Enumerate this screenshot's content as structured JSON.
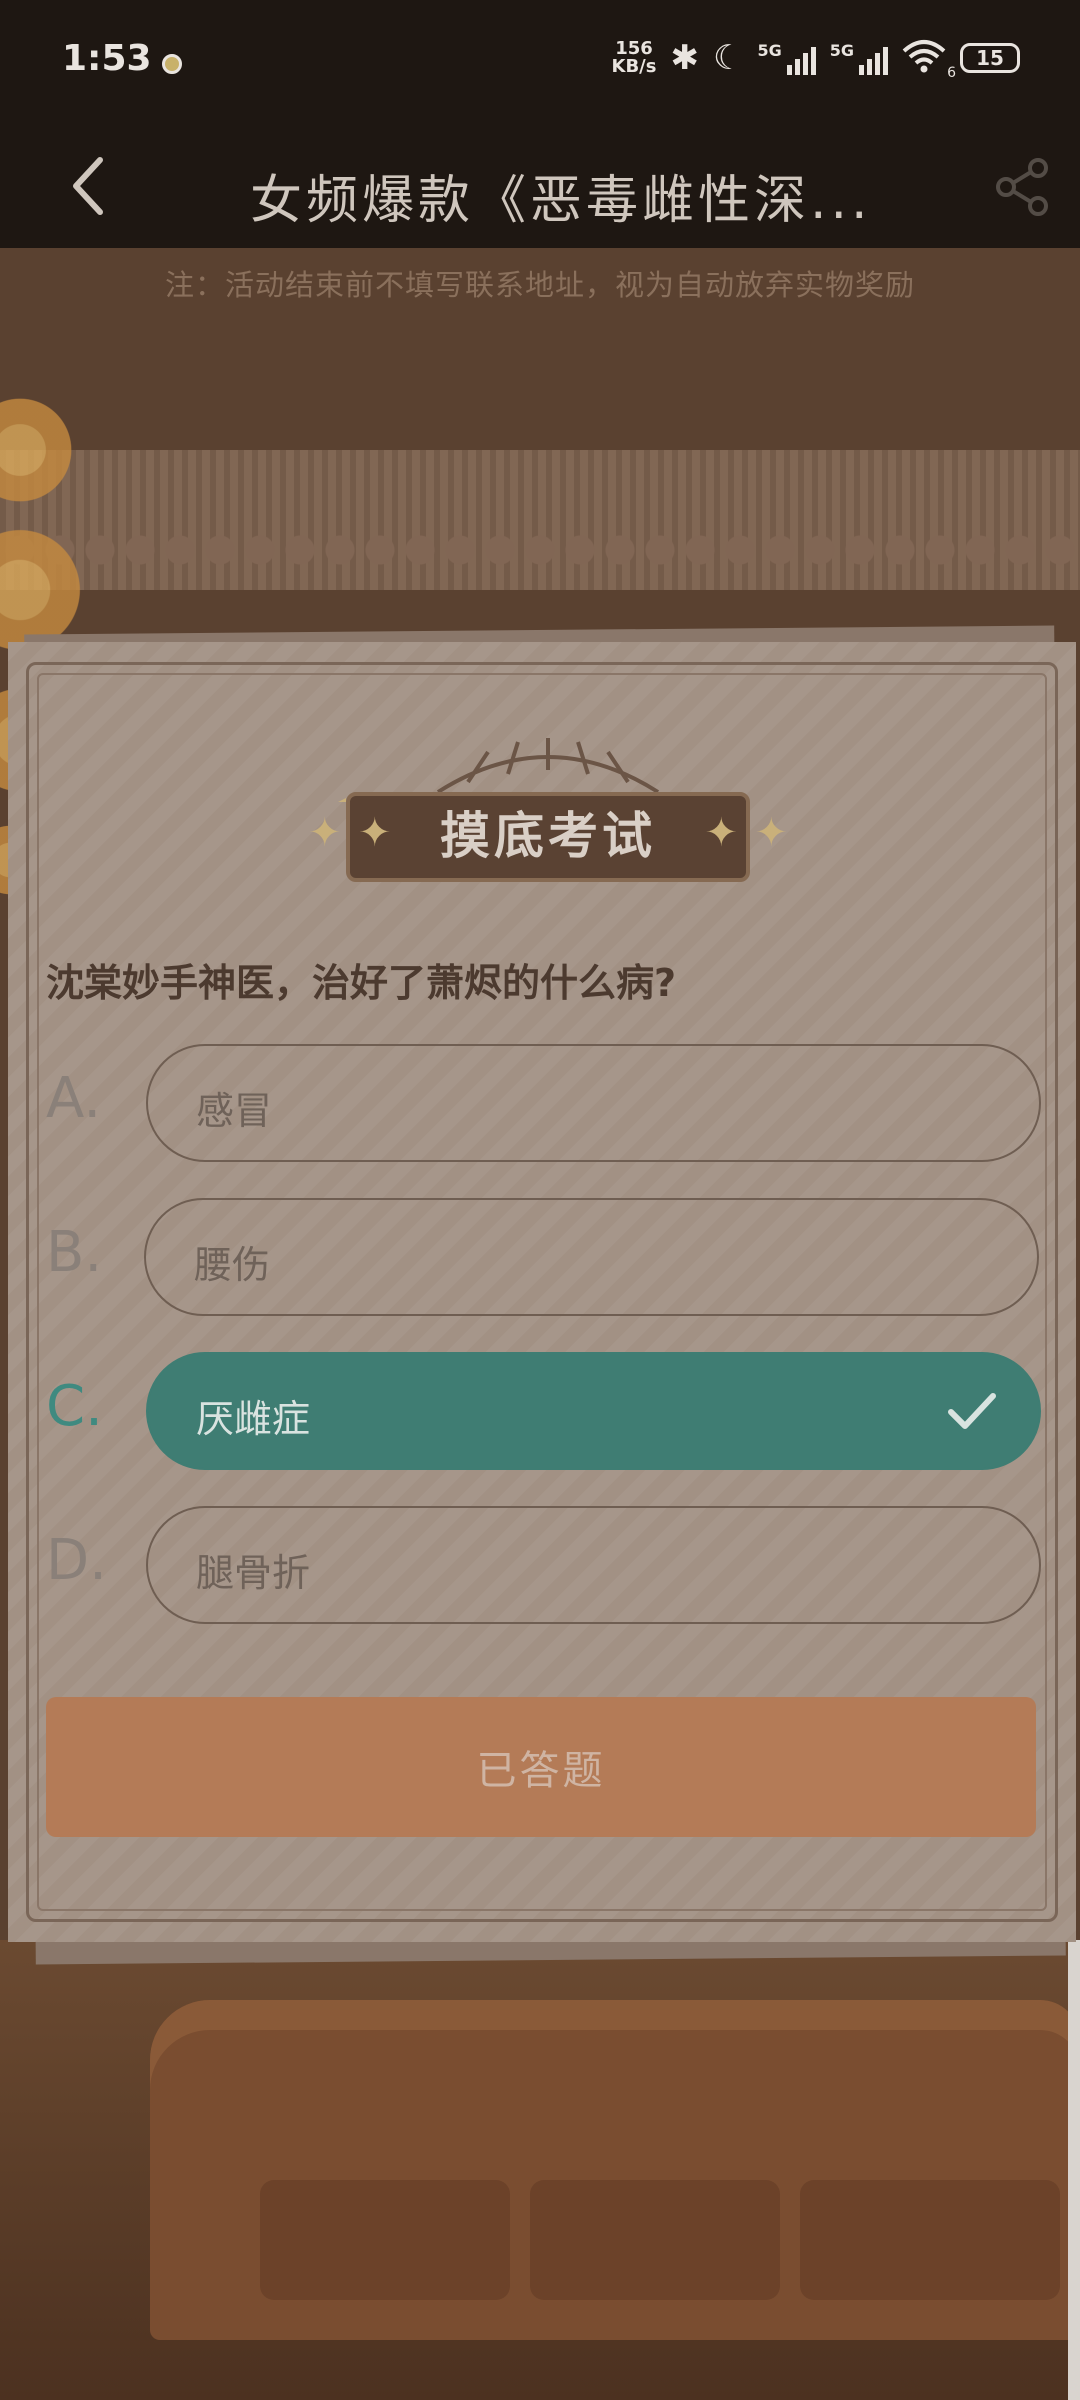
{
  "status_bar": {
    "time": "1:53",
    "net_speed_value": "156",
    "net_speed_unit": "KB/s",
    "signal1_label": "5G",
    "signal2_label": "5G",
    "wifi_sub": "6",
    "battery": "15"
  },
  "header": {
    "title": "女频爆款《恶毒雌性深..."
  },
  "notice": "注：活动结束前不填写联系地址，视为自动放弃实物奖励",
  "quiz": {
    "badge_title": "摸底考试",
    "question": "沈棠妙手神医，治好了萧烬的什么病?",
    "options": [
      {
        "letter": "A.",
        "text": "感冒"
      },
      {
        "letter": "B.",
        "text": "腰伤"
      },
      {
        "letter": "C.",
        "text": "厌雌症"
      },
      {
        "letter": "D.",
        "text": "腿骨折"
      }
    ],
    "selected_index": 2,
    "submit_label": "已答题"
  },
  "colors": {
    "status_bg": "#1e1712",
    "selected": "#3f7d73",
    "button": "#b47b57"
  }
}
